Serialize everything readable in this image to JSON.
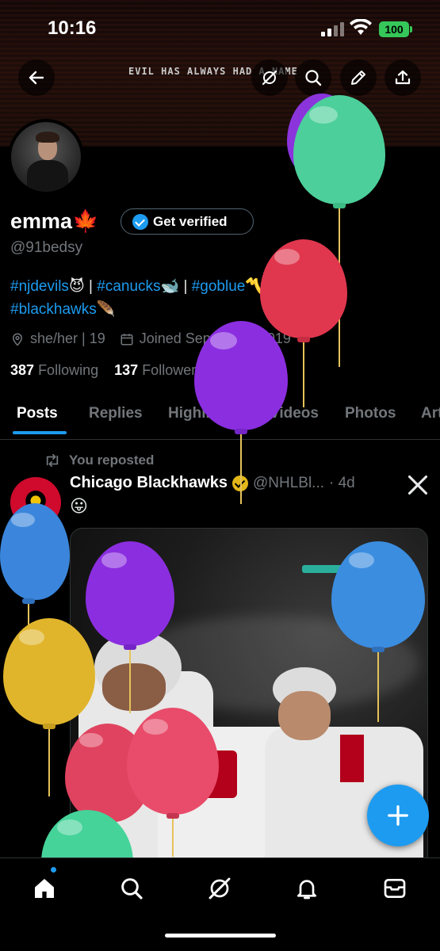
{
  "status_bar": {
    "time": "10:16",
    "battery": "100"
  },
  "banner": {
    "text": "EVIL HAS ALWAYS HAD A NAME"
  },
  "profile": {
    "name": "emma",
    "name_emoji": "🍁",
    "verify_label": "Get verified",
    "handle": "@91bedsy",
    "bio_tags": [
      {
        "text": "#njdevils",
        "emoji": "😈"
      },
      {
        "text": "#canucks",
        "emoji": "🐋"
      },
      {
        "text": "#goblue",
        "emoji": "〽️"
      },
      {
        "text": "#blackhawks",
        "emoji": "🪶"
      }
    ],
    "bio_separator": "|",
    "pronouns": "she/her | 19",
    "joined": "Joined September 2019",
    "following_count": "387",
    "following_label": "Following",
    "followers_count": "137",
    "followers_label": "Followers"
  },
  "tabs": [
    "Posts",
    "Replies",
    "Highlights",
    "Videos",
    "Photos",
    "Articles"
  ],
  "post": {
    "repost_label": "You reposted",
    "author": "Chicago Blackhawks",
    "username": "@NHLBl...",
    "time": "· 4d",
    "text": "😛"
  },
  "icons": {
    "back": "back-arrow-icon",
    "grok": "grok-icon",
    "search": "search-icon",
    "edit": "pencil-icon",
    "share": "share-icon",
    "location": "location-icon",
    "calendar": "calendar-icon",
    "repost": "repost-icon",
    "x_logo": "x-logo-icon",
    "compose": "plus-icon",
    "nav": [
      "home-icon",
      "search-icon",
      "grok-icon",
      "bell-icon",
      "mail-icon"
    ]
  },
  "colors": {
    "accent": "#1d9bf0",
    "balloons": [
      "#7d2ed8",
      "#4ccf9a",
      "#e0374e",
      "#8b2ee0",
      "#3b8de0",
      "#e0b52c",
      "#e0435f",
      "#45d39a"
    ]
  }
}
